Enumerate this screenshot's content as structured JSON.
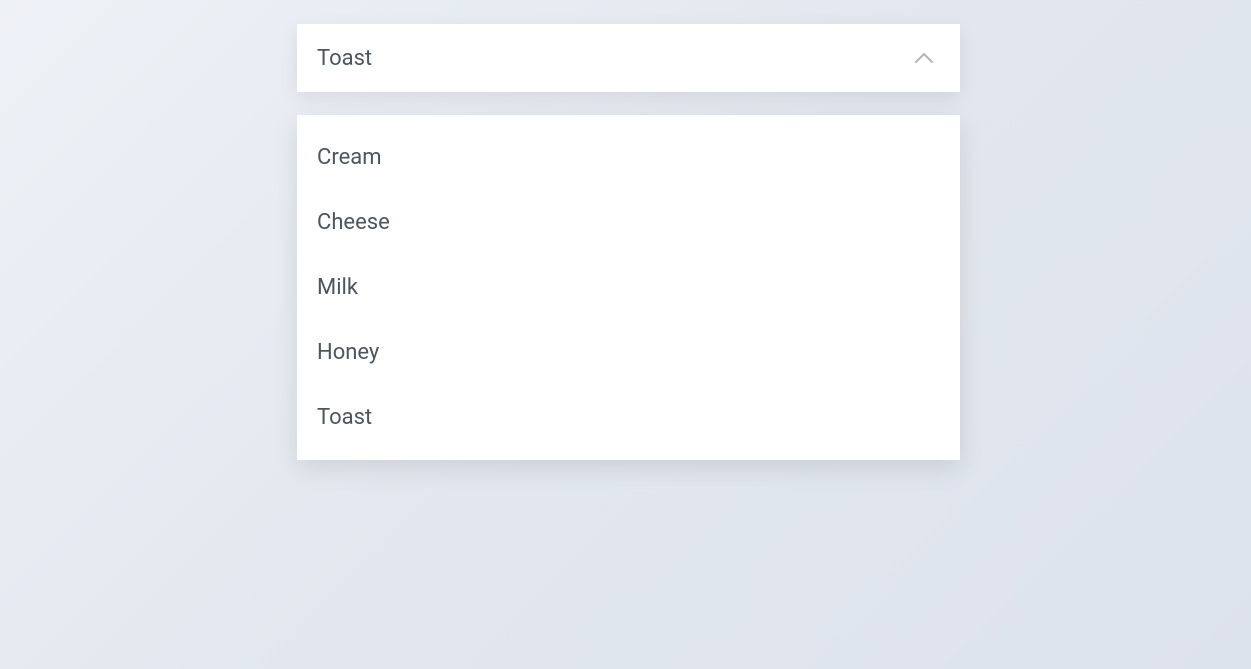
{
  "dropdown": {
    "selected": "Toast",
    "options": [
      "Cream",
      "Cheese",
      "Milk",
      "Honey",
      "Toast"
    ]
  }
}
